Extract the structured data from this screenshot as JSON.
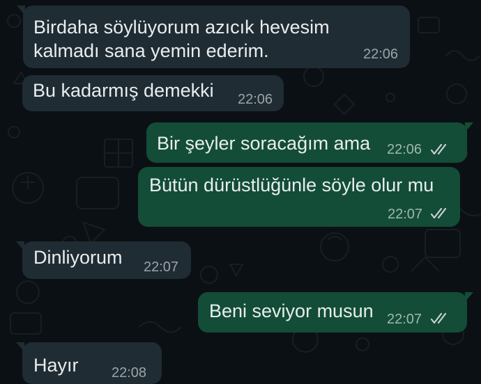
{
  "colors": {
    "background": "#0b1014",
    "incoming_bubble": "#1f2c33",
    "outgoing_bubble": "#134d37",
    "text": "#e9edef",
    "read_ticks": "#c9d1d4"
  },
  "messages": [
    {
      "direction": "incoming",
      "text": "Birdaha söylüyorum azıcık hevesim\nkalmadı sana yemin ederim.",
      "time": "22:06"
    },
    {
      "direction": "incoming",
      "text": "Bu kadarmış demekki",
      "time": "22:06"
    },
    {
      "direction": "outgoing",
      "text": "Bir şeyler soracağım ama",
      "time": "22:06",
      "status_icon": "double-check-icon"
    },
    {
      "direction": "outgoing",
      "text": "Bütün dürüstlüğünle söyle olur mu",
      "time": "22:07",
      "status_icon": "double-check-icon"
    },
    {
      "direction": "incoming",
      "text": "Dinliyorum",
      "time": "22:07"
    },
    {
      "direction": "outgoing",
      "text": "Beni seviyor musun",
      "time": "22:07",
      "status_icon": "double-check-icon"
    },
    {
      "direction": "incoming",
      "text": "Hayır",
      "time": "22:08"
    }
  ]
}
